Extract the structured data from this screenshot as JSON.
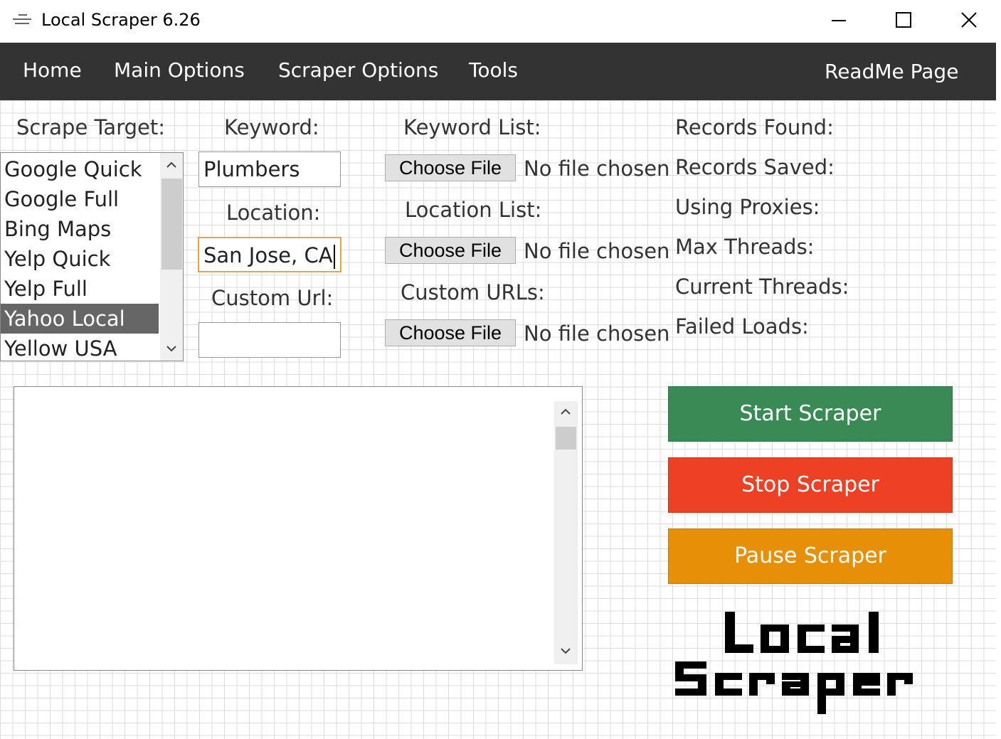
{
  "window": {
    "title": "Local Scraper 6.26"
  },
  "menu": {
    "home": "Home",
    "main_options": "Main Options",
    "scraper_options": "Scraper Options",
    "tools": "Tools",
    "readme": "ReadMe Page"
  },
  "scrape_target": {
    "label": "Scrape Target:",
    "items": [
      "Google Quick",
      "Google Full",
      "Bing Maps",
      "Yelp Quick",
      "Yelp Full",
      "Yahoo Local",
      "Yellow USA"
    ],
    "selected": "Yahoo Local"
  },
  "keyword": {
    "label": "Keyword:",
    "value": "Plumbers"
  },
  "location": {
    "label": "Location:",
    "value": "San Jose, CA"
  },
  "custom_url": {
    "label": "Custom Url:",
    "value": ""
  },
  "keyword_list": {
    "label": "Keyword List:",
    "button": "Choose File",
    "status": "No file chosen"
  },
  "location_list": {
    "label": "Location List:",
    "button": "Choose File",
    "status": "No file chosen"
  },
  "custom_urls": {
    "label": "Custom URLs:",
    "button": "Choose File",
    "status": "No file chosen"
  },
  "stats": {
    "records_found": "Records Found:",
    "records_saved": "Records Saved:",
    "using_proxies": "Using Proxies:",
    "max_threads": "Max Threads:",
    "current_threads": "Current Threads:",
    "failed_loads": "Failed Loads:"
  },
  "actions": {
    "start": "Start Scraper",
    "stop": "Stop Scraper",
    "pause": "Pause Scraper"
  },
  "logo": {
    "line1": "Local",
    "line2": "Scraper"
  },
  "colors": {
    "menu_bg": "#333333",
    "start": "#3a8a55",
    "stop": "#ee4025",
    "pause": "#e88f08",
    "selected_item": "#666666",
    "focus_border": "#e5a73a"
  },
  "icons": {
    "app": "scraper-app-icon",
    "minimize": "minimize-icon",
    "maximize": "maximize-icon",
    "close": "close-icon",
    "scroll_up": "chevron-up-icon",
    "scroll_down": "chevron-down-icon"
  }
}
